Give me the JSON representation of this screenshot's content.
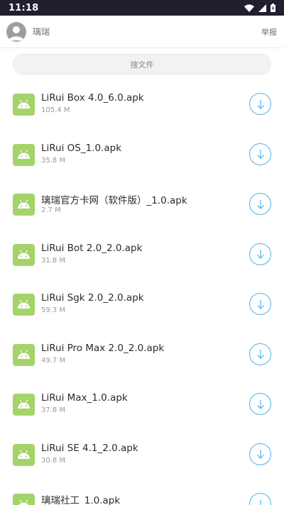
{
  "status_bar": {
    "time": "11:18",
    "icons": [
      "wifi-icon",
      "signal-icon",
      "battery-charging-icon"
    ]
  },
  "header": {
    "avatar_icon": "person-icon",
    "user_name": "璃瑞",
    "report_label": "举报"
  },
  "search": {
    "placeholder": "搜文件"
  },
  "colors": {
    "accent": "#4fb0e6",
    "file_icon_bg": "#a4d36a",
    "status_bar_bg": "#1f1f2e"
  },
  "files": [
    {
      "name": "LiRui Box 4.0_6.0.apk",
      "size": "105.4 M"
    },
    {
      "name": "LiRui OS_1.0.apk",
      "size": "35.8 M"
    },
    {
      "name": "璃瑞官方卡网（软件版）_1.0.apk",
      "size": "2.7 M"
    },
    {
      "name": "LiRui Bot 2.0_2.0.apk",
      "size": "31.8 M"
    },
    {
      "name": "LiRui Sgk 2.0_2.0.apk",
      "size": "59.3 M"
    },
    {
      "name": "LiRui Pro Max 2.0_2.0.apk",
      "size": "49.7 M"
    },
    {
      "name": "LiRui Max_1.0.apk",
      "size": "37.8 M"
    },
    {
      "name": "LiRui SE 4.1_2.0.apk",
      "size": "30.8 M"
    },
    {
      "name": "璃瑞社工_1.0.apk",
      "size": ""
    }
  ]
}
